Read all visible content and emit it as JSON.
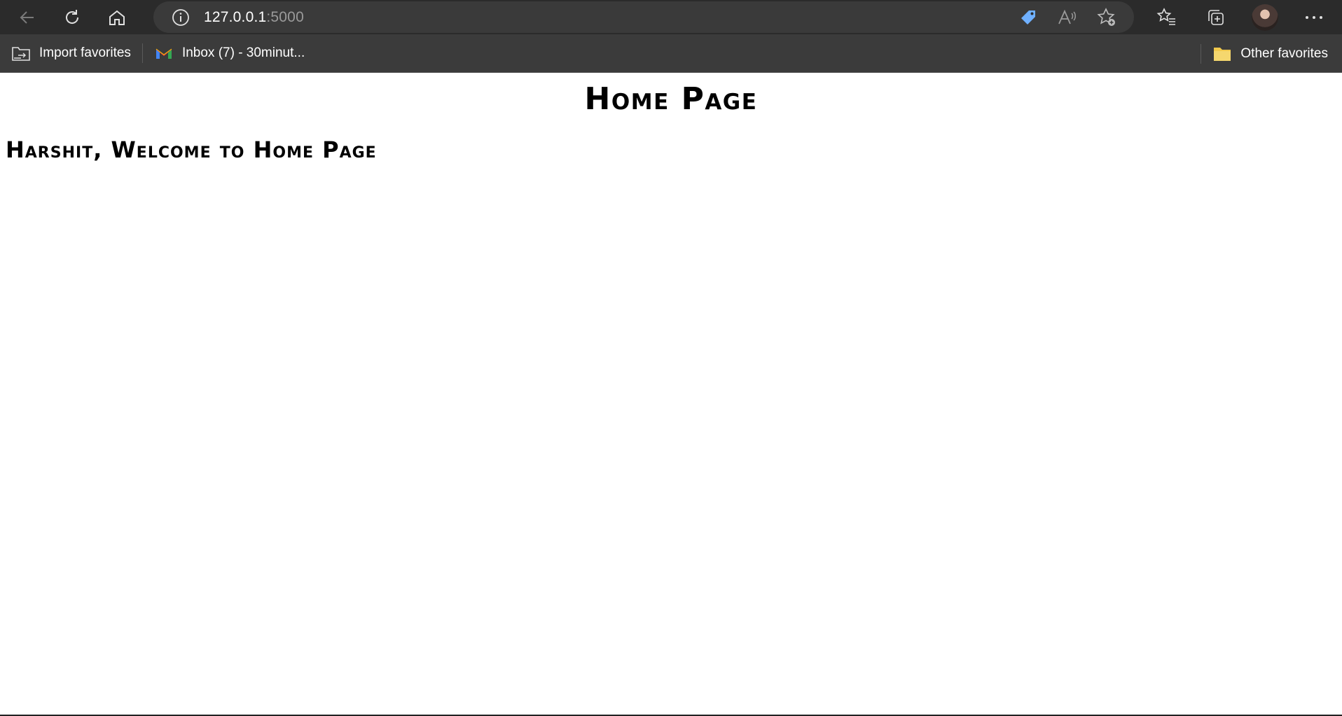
{
  "browser": {
    "url_host": "127.0.0.1",
    "url_port": ":5000",
    "icons": {
      "back": "back-arrow-icon",
      "refresh": "refresh-icon",
      "home": "home-icon",
      "info": "info-icon",
      "coupon": "tag-icon",
      "read_aloud": "read-aloud-icon",
      "add_favorite": "add-favorite-icon",
      "favorites": "favorites-icon",
      "collections": "collections-icon",
      "profile": "avatar",
      "more": "more-icon"
    }
  },
  "favorites_bar": {
    "items": [
      {
        "label": "Import favorites",
        "icon": "import-folder-icon"
      },
      {
        "label": "Inbox (7) - 30minut...",
        "icon": "gmail-icon"
      }
    ],
    "other": {
      "label": "Other favorites",
      "icon": "folder-icon"
    }
  },
  "page": {
    "title": "Home Page",
    "welcome": "Harshit, Welcome to Home Page"
  },
  "colors": {
    "toolbar_bg": "#2b2b2b",
    "address_bg": "#3a3a3a",
    "favbar_bg": "#3b3b3b",
    "tag_blue": "#6fb0ff",
    "folder_yellow": "#f2c94c"
  }
}
